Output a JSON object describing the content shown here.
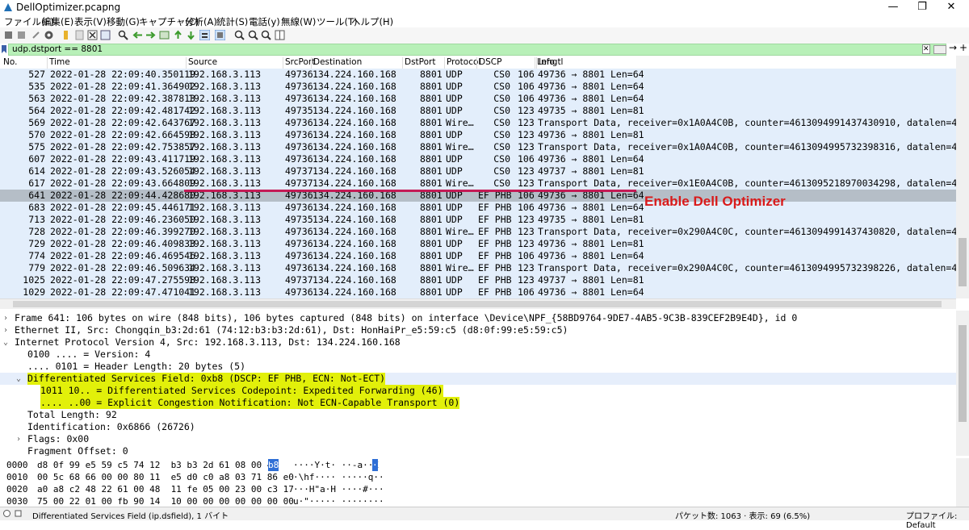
{
  "window": {
    "title": "DellOptimizer.pcapng",
    "min": "—",
    "max": "❐",
    "close": "✕"
  },
  "menu": [
    "ファイル(F)",
    "編集(E)",
    "表示(V)",
    "移動(G)",
    "キャプチャ(C)",
    "分析(A)",
    "統計(S)",
    "電話(y)",
    "無線(W)",
    "ツール(T)",
    "ヘルプ(H)"
  ],
  "filter": {
    "value": "udp.dstport == 8801",
    "clear": "✕",
    "apply": "→",
    "add": "+"
  },
  "columns": [
    "No.",
    "Time",
    "Source",
    "SrcPort",
    "Destination",
    "DstPort",
    "Protocol",
    "DSCP",
    "Lengtl",
    "Info"
  ],
  "packets": [
    [
      "527",
      "2022-01-28 22:09:40.350119",
      "192.168.3.113",
      "49736",
      "134.224.160.168",
      "8801",
      "UDP",
      "CS0",
      "106",
      "49736 → 8801 Len=64"
    ],
    [
      "535",
      "2022-01-28 22:09:41.364902",
      "192.168.3.113",
      "49736",
      "134.224.160.168",
      "8801",
      "UDP",
      "CS0",
      "106",
      "49736 → 8801 Len=64"
    ],
    [
      "563",
      "2022-01-28 22:09:42.387813",
      "192.168.3.113",
      "49736",
      "134.224.160.168",
      "8801",
      "UDP",
      "CS0",
      "106",
      "49736 → 8801 Len=64"
    ],
    [
      "564",
      "2022-01-28 22:09:42.481742",
      "192.168.3.113",
      "49735",
      "134.224.160.168",
      "8801",
      "UDP",
      "CS0",
      "123",
      "49735 → 8801 Len=81"
    ],
    [
      "569",
      "2022-01-28 22:09:42.643767",
      "192.168.3.113",
      "49736",
      "134.224.160.168",
      "8801",
      "Wire…",
      "CS0",
      "123",
      "Transport Data, receiver=0x1A0A4C0B, counter=4613094991437430910, datalen=49"
    ],
    [
      "570",
      "2022-01-28 22:09:42.664598",
      "192.168.3.113",
      "49736",
      "134.224.160.168",
      "8801",
      "UDP",
      "CS0",
      "123",
      "49736 → 8801 Len=81"
    ],
    [
      "575",
      "2022-01-28 22:09:42.753857",
      "192.168.3.113",
      "49736",
      "134.224.160.168",
      "8801",
      "Wire…",
      "CS0",
      "123",
      "Transport Data, receiver=0x1A0A4C0B, counter=4613094995732398316, datalen=49"
    ],
    [
      "607",
      "2022-01-28 22:09:43.411719",
      "192.168.3.113",
      "49736",
      "134.224.160.168",
      "8801",
      "UDP",
      "CS0",
      "106",
      "49736 → 8801 Len=64"
    ],
    [
      "614",
      "2022-01-28 22:09:43.526054",
      "192.168.3.113",
      "49737",
      "134.224.160.168",
      "8801",
      "UDP",
      "CS0",
      "123",
      "49737 → 8801 Len=81"
    ],
    [
      "617",
      "2022-01-28 22:09:43.664809",
      "192.168.3.113",
      "49737",
      "134.224.160.168",
      "8801",
      "Wire…",
      "CS0",
      "123",
      "Transport Data, receiver=0x1E0A4C0B, counter=4613095218970034298, datalen=49"
    ],
    [
      "641",
      "2022-01-28 22:09:44.428680",
      "192.168.3.113",
      "49736",
      "134.224.160.168",
      "8801",
      "UDP",
      "EF PHB",
      "106",
      "49736 → 8801 Len=64"
    ],
    [
      "683",
      "2022-01-28 22:09:45.446171",
      "192.168.3.113",
      "49736",
      "134.224.160.168",
      "8801",
      "UDP",
      "EF PHB",
      "106",
      "49736 → 8801 Len=64"
    ],
    [
      "713",
      "2022-01-28 22:09:46.236050",
      "192.168.3.113",
      "49735",
      "134.224.160.168",
      "8801",
      "UDP",
      "EF PHB",
      "123",
      "49735 → 8801 Len=81"
    ],
    [
      "728",
      "2022-01-28 22:09:46.399270",
      "192.168.3.113",
      "49736",
      "134.224.160.168",
      "8801",
      "Wire…",
      "EF PHB",
      "123",
      "Transport Data, receiver=0x290A4C0C, counter=4613094991437430820, datalen=49"
    ],
    [
      "729",
      "2022-01-28 22:09:46.409833",
      "192.168.3.113",
      "49736",
      "134.224.160.168",
      "8801",
      "UDP",
      "EF PHB",
      "123",
      "49736 → 8801 Len=81"
    ],
    [
      "774",
      "2022-01-28 22:09:46.469546",
      "192.168.3.113",
      "49736",
      "134.224.160.168",
      "8801",
      "UDP",
      "EF PHB",
      "106",
      "49736 → 8801 Len=64"
    ],
    [
      "779",
      "2022-01-28 22:09:46.509634",
      "192.168.3.113",
      "49736",
      "134.224.160.168",
      "8801",
      "Wire…",
      "EF PHB",
      "123",
      "Transport Data, receiver=0x290A4C0C, counter=4613094995732398226, datalen=49"
    ],
    [
      "1025",
      "2022-01-28 22:09:47.275598",
      "192.168.3.113",
      "49737",
      "134.224.160.168",
      "8801",
      "UDP",
      "EF PHB",
      "123",
      "49737 → 8801 Len=81"
    ],
    [
      "1029",
      "2022-01-28 22:09:47.471041",
      "192.168.3.113",
      "49736",
      "134.224.160.168",
      "8801",
      "UDP",
      "EF PHB",
      "106",
      "49736 → 8801 Len=64"
    ]
  ],
  "selected_row": "641",
  "annotation": "Enable Dell Optimizer",
  "details": [
    {
      "twist": ">",
      "text": "Frame 641: 106 bytes on wire (848 bits), 106 bytes captured (848 bits) on interface \\Device\\NPF_{58BD9764-9DE7-4AB5-9C3B-839CEF2B9E4D}, id 0",
      "indent": 0
    },
    {
      "twist": ">",
      "text": "Ethernet II, Src: Chongqin_b3:2d:61 (74:12:b3:b3:2d:61), Dst: HonHaiPr_e5:59:c5 (d8:0f:99:e5:59:c5)",
      "indent": 0
    },
    {
      "twist": "v",
      "text": "Internet Protocol Version 4, Src: 192.168.3.113, Dst: 134.224.160.168",
      "indent": 0
    },
    {
      "twist": "",
      "text": "0100 .... = Version: 4",
      "indent": 1
    },
    {
      "twist": "",
      "text": ".... 0101 = Header Length: 20 bytes (5)",
      "indent": 1
    },
    {
      "twist": "v",
      "text": "Differentiated Services Field: 0xb8 (DSCP: EF PHB, ECN: Not-ECT)",
      "indent": 1,
      "hl": "yel-sel"
    },
    {
      "twist": "",
      "text": "1011 10.. = Differentiated Services Codepoint: Expedited Forwarding (46)",
      "indent": 2,
      "hl": "yel"
    },
    {
      "twist": "",
      "text": ".... ..00 = Explicit Congestion Notification: Not ECN-Capable Transport (0)",
      "indent": 2,
      "hl": "yel"
    },
    {
      "twist": "",
      "text": "Total Length: 92",
      "indent": 1
    },
    {
      "twist": "",
      "text": "Identification: 0x6866 (26726)",
      "indent": 1
    },
    {
      "twist": ">",
      "text": "Flags: 0x00",
      "indent": 1
    },
    {
      "twist": "",
      "text": "Fragment Offset: 0",
      "indent": 1
    }
  ],
  "hex": [
    {
      "off": "0000",
      "bytes": "d8 0f 99 e5 59 c5 74 12  b3 b3 2d 61 08 00 45 ",
      "sel": "b8",
      "ascii": "····Y·t· ··-a··E",
      "ascii_sel": "·"
    },
    {
      "off": "0010",
      "bytes": "00 5c 68 66 00 00 80 11  e5 d0 c0 a8 03 71 86 e0",
      "sel": "",
      "ascii": "·\\hf···· ·····q··",
      "ascii_sel": ""
    },
    {
      "off": "0020",
      "bytes": "a0 a8 c2 48 22 61 00 48  11 fe 05 00 23 00 c3 17",
      "sel": "",
      "ascii": "···H\"a·H ····#···",
      "ascii_sel": ""
    },
    {
      "off": "0030",
      "bytes": "75 00 22 01 00 fb 90 14  10 00 00 00 00 00 00 00",
      "sel": "",
      "ascii": "u·\"····· ········",
      "ascii_sel": ""
    }
  ],
  "status": {
    "field": "Differentiated Services Field (ip.dsfield), 1 バイト",
    "packets": "パケット数: 1063 · 表示: 69 (6.5%)",
    "profile": "プロファイル: Default"
  }
}
